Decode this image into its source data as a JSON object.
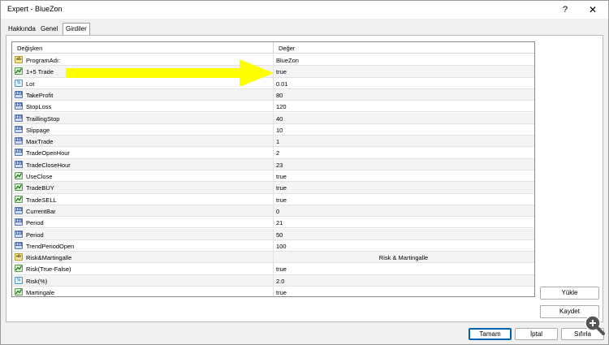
{
  "window": {
    "title": "Expert - BlueZon",
    "help_glyph": "?",
    "close_glyph": "✕"
  },
  "tabs": [
    {
      "label": "Hakkında"
    },
    {
      "label": "Genel"
    },
    {
      "label": "Girdiler"
    }
  ],
  "active_tab": "Girdiler",
  "grid": {
    "columns": {
      "variable": "Değişken",
      "value": "Değer"
    },
    "rows": [
      {
        "icon": "string-icon",
        "icon_text": "ab",
        "name": "ProgramAdı:",
        "value": "BlueZon"
      },
      {
        "icon": "bool-icon",
        "icon_text": "",
        "name": "1+5 Trade",
        "value": "true"
      },
      {
        "icon": "double-icon",
        "icon_text": "½",
        "name": "Lot",
        "value": "0.01"
      },
      {
        "icon": "integer-icon",
        "icon_text": "123",
        "name": "TakeProfit",
        "value": "80"
      },
      {
        "icon": "integer-icon",
        "icon_text": "123",
        "name": "StopLoss",
        "value": "120"
      },
      {
        "icon": "integer-icon",
        "icon_text": "123",
        "name": "TraillingStop",
        "value": "40"
      },
      {
        "icon": "integer-icon",
        "icon_text": "123",
        "name": "Slippage",
        "value": "10"
      },
      {
        "icon": "integer-icon",
        "icon_text": "123",
        "name": "MaxTrade",
        "value": "1"
      },
      {
        "icon": "integer-icon",
        "icon_text": "123",
        "name": "TradeOpenHour",
        "value": "2"
      },
      {
        "icon": "integer-icon",
        "icon_text": "123",
        "name": "TradeCloseHour",
        "value": "23"
      },
      {
        "icon": "bool-icon",
        "icon_text": "",
        "name": "UseClose",
        "value": "true"
      },
      {
        "icon": "bool-icon",
        "icon_text": "",
        "name": "TradeBUY",
        "value": "true"
      },
      {
        "icon": "bool-icon",
        "icon_text": "",
        "name": "TradeSELL",
        "value": "true"
      },
      {
        "icon": "integer-icon",
        "icon_text": "123",
        "name": "CurrentBar",
        "value": "0"
      },
      {
        "icon": "integer-icon",
        "icon_text": "123",
        "name": "Period",
        "value": "21"
      },
      {
        "icon": "integer-icon",
        "icon_text": "123",
        "name": "Period",
        "value": "50"
      },
      {
        "icon": "integer-icon",
        "icon_text": "123",
        "name": "TrendPeriodOpen",
        "value": "100"
      },
      {
        "icon": "string-icon",
        "icon_text": "ab",
        "name": "Risk&Martingalle",
        "value": "Risk & Martingalle",
        "centered": true
      },
      {
        "icon": "bool-icon",
        "icon_text": "",
        "name": "Risk(True-False)",
        "value": "true"
      },
      {
        "icon": "double-icon",
        "icon_text": "½",
        "name": "Risk(%)",
        "value": "2.0"
      },
      {
        "icon": "bool-icon",
        "icon_text": "",
        "name": "Martingale",
        "value": "true"
      }
    ]
  },
  "buttons": {
    "load": "Yükle",
    "save": "Kaydet",
    "ok": "Tamam",
    "cancel": "İptal",
    "reset": "Sıfırla"
  },
  "annotation": {
    "arrow_color": "#ffff00"
  }
}
